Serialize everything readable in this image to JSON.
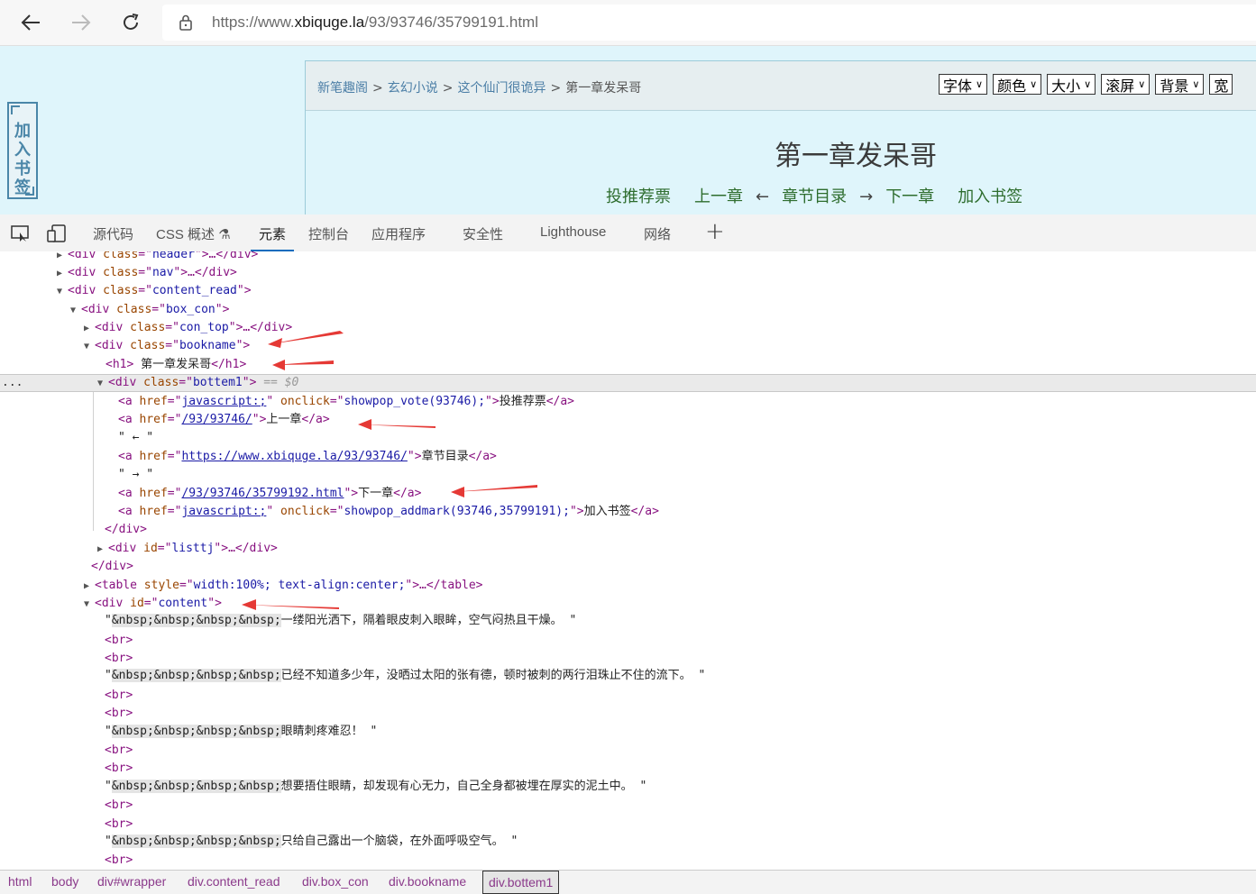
{
  "browser": {
    "url_prefix": "https://www.",
    "url_domain": "xbiquge.la",
    "url_path": "/93/93746/35799191.html"
  },
  "page": {
    "side_bookmark": "加入书签",
    "breadcrumb": [
      "新笔趣阁",
      "玄幻小说",
      "这个仙门很诡异",
      "第一章发呆哥"
    ],
    "breadcrumb_sep": ">",
    "selects": [
      "字体",
      "颜色",
      "大小",
      "滚屏",
      "背景",
      "宽"
    ],
    "title": "第一章发呆哥",
    "links": {
      "vote": "投推荐票",
      "prev": "上一章",
      "arrow_left": "←",
      "toc": "章节目录",
      "arrow_right": "→",
      "next": "下一章",
      "addmark": "加入书签"
    }
  },
  "devtools": {
    "tabs": [
      "源代码",
      "CSS 概述",
      "元素",
      "控制台",
      "应用程序",
      "安全性",
      "Lighthouse",
      "网络"
    ],
    "active_tab": "元素",
    "selected_marker": "== $0",
    "more_dots": "...",
    "dom_lines": {
      "l1": {
        "tag": "div",
        "attr": "class",
        "val": "header",
        "rest": ">…</div>"
      },
      "l2": {
        "tag": "div",
        "attr": "class",
        "val": "nav",
        "rest": ">…</div>"
      },
      "l3": {
        "tag": "div",
        "attr": "class",
        "val": "content_read",
        "rest": ">"
      },
      "l4": {
        "tag": "div",
        "attr": "class",
        "val": "box_con",
        "rest": ">"
      },
      "l5": {
        "tag": "div",
        "attr": "class",
        "val": "con_top",
        "rest": ">…</div>"
      },
      "l6": {
        "tag": "div",
        "attr": "class",
        "val": "bookname",
        "rest": ">"
      },
      "l7": {
        "open": "<h1>",
        "text": " 第一章发呆哥",
        "close": "</h1>"
      },
      "l8": {
        "tag": "div",
        "attr": "class",
        "val": "bottem1",
        "rest": ">"
      },
      "l9": {
        "href": "javascript:;",
        "extra_attr": "onclick",
        "extra_val": "showpop_vote(93746);",
        "text": "投推荐票"
      },
      "l10": {
        "href": "/93/93746/",
        "text": "上一章"
      },
      "l11": {
        "text": "\" ← \""
      },
      "l12": {
        "href": "https://www.xbiquge.la/93/93746/",
        "text": "章节目录"
      },
      "l13": {
        "text": "\" → \""
      },
      "l14": {
        "href": "/93/93746/35799192.html",
        "text": "下一章"
      },
      "l15": {
        "href": "javascript:;",
        "extra_attr": "onclick",
        "extra_val": "showpop_addmark(93746,35799191);",
        "text": "加入书签"
      },
      "l16": "</div>",
      "l17": {
        "tag": "div",
        "attr": "id",
        "val": "listtj",
        "rest": ">…</div>"
      },
      "l18": "</div>",
      "l19": {
        "tag": "table",
        "attr": "style",
        "val": "width:100%; text-align:center;",
        "rest": ">…</table>"
      },
      "l20": {
        "tag": "div",
        "attr": "id",
        "val": "content",
        "rest": ">"
      },
      "nbsp": "&nbsp;&nbsp;&nbsp;&nbsp;",
      "br": "<br>",
      "p1": "一缕阳光洒下，隔着眼皮刺入眼眸，空气闷热且干燥。",
      "p2": "已经不知道多少年，没晒过太阳的张有德，顿时被刺的两行泪珠止不住的流下。",
      "p3": "眼睛刺疼难忍！",
      "p4": "想要捂住眼睛，却发现有心无力，自己全身都被埋在厚实的泥土中。",
      "p5": "只给自己露出一个脑袋，在外面呼吸空气。"
    },
    "crumbs": [
      "html",
      "body",
      "div#wrapper",
      "div.content_read",
      "div.box_con",
      "div.bookname",
      "div.bottem1"
    ]
  }
}
